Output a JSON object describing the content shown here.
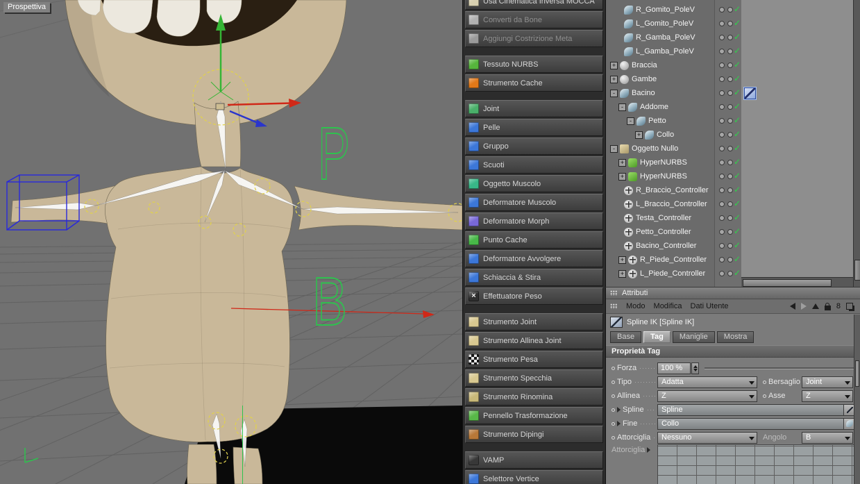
{
  "colors": {
    "viewport_bg": "#717171",
    "model_skin": "#c9b899",
    "gizmo_green": "#35b535",
    "gizmo_red": "#d02818",
    "gizmo_blue": "#2a35cc",
    "joint_circle_yellow": "#e0d14e",
    "overlay_letter_green": "#2ec24e",
    "wire_cube_blue": "#2828dc",
    "check_green": "#2fd14a",
    "selected_tag_blue": "#8da8dc"
  },
  "viewport": {
    "label": "Prospettiva",
    "overlay_letters": [
      "P",
      "B"
    ]
  },
  "palette": {
    "groups": [
      {
        "items": [
          {
            "label": "Usa Cinematica Inversa MOCCA",
            "icon": "ik-mocca-icon",
            "color": "#d8d0b0",
            "disabled": false
          },
          {
            "label": "Converti da Bone",
            "icon": "convert-bone-icon",
            "color": "#b0b0b0",
            "disabled": true
          },
          {
            "label": "Aggiungi Costrizione Meta",
            "icon": "meta-constraint-icon",
            "color": "#9a9a9a",
            "disabled": true
          }
        ]
      },
      {
        "items": [
          {
            "label": "Tessuto NURBS",
            "icon": "cloth-nurbs-icon",
            "color": "#56b53c"
          },
          {
            "label": "Strumento Cache",
            "icon": "cache-tool-icon",
            "color": "#e07818"
          }
        ]
      },
      {
        "items": [
          {
            "label": "Joint",
            "icon": "joint-icon",
            "color": "#4ab06a"
          },
          {
            "label": "Pelle",
            "icon": "skin-icon",
            "color": "#3c77d8"
          },
          {
            "label": "Gruppo",
            "icon": "cluster-icon",
            "color": "#3c77d8"
          },
          {
            "label": "Scuoti",
            "icon": "jiggle-icon",
            "color": "#3c77d8"
          },
          {
            "label": "Oggetto Muscolo",
            "icon": "muscle-object-icon",
            "color": "#38b888"
          },
          {
            "label": "Deformatore Muscolo",
            "icon": "muscle-deformer-icon",
            "color": "#3c77d8"
          },
          {
            "label": "Deformatore Morph",
            "icon": "morph-deformer-icon",
            "color": "#7868d8"
          },
          {
            "label": "Punto Cache",
            "icon": "point-cache-icon",
            "color": "#48b848"
          },
          {
            "label": "Deformatore Avvolgere",
            "icon": "wrap-deformer-icon",
            "color": "#3c77d8"
          },
          {
            "label": "Schiaccia & Stira",
            "icon": "squash-stretch-icon",
            "color": "#3c77d8"
          },
          {
            "label": "Effettuatore Peso",
            "icon": "weight-effector-icon",
            "color": "#2e2e2e",
            "glyph": "×"
          }
        ]
      },
      {
        "items": [
          {
            "label": "Strumento Joint",
            "icon": "joint-tool-icon",
            "color": "#d8c890"
          },
          {
            "label": "Strumento Allinea Joint",
            "icon": "align-joint-tool-icon",
            "color": "#d8c890"
          },
          {
            "label": "Strumento Pesa",
            "icon": "weight-tool-icon",
            "color": "#202020",
            "checker": true
          },
          {
            "label": "Strumento Specchia",
            "icon": "mirror-tool-icon",
            "color": "#d8c890"
          },
          {
            "label": "Strumento Rinomina",
            "icon": "rename-tool-icon",
            "color": "#c8b878"
          },
          {
            "label": "Pennello Trasformazione",
            "icon": "transform-brush-icon",
            "color": "#58b848"
          },
          {
            "label": "Strumento Dipingi",
            "icon": "paint-tool-icon",
            "color": "#b87838"
          }
        ]
      },
      {
        "items": [
          {
            "label": "VAMP",
            "icon": "vamp-icon",
            "color": "#383838"
          },
          {
            "label": "Selettore Vertice",
            "icon": "vertex-selector-icon",
            "color": "#3c77d8"
          }
        ]
      }
    ]
  },
  "object_manager": {
    "items": [
      {
        "name": "R_Gomito_PoleV",
        "level": 1,
        "expander": null,
        "icon": "joint"
      },
      {
        "name": "L_Gomito_PoleV",
        "level": 1,
        "expander": null,
        "icon": "joint"
      },
      {
        "name": "R_Gamba_PoleV",
        "level": 1,
        "expander": null,
        "icon": "joint"
      },
      {
        "name": "L_Gamba_PoleV",
        "level": 1,
        "expander": null,
        "icon": "joint"
      },
      {
        "name": "Braccia",
        "level": 0,
        "expander": "plus",
        "icon": "group"
      },
      {
        "name": "Gambe",
        "level": 0,
        "expander": "plus",
        "icon": "group"
      },
      {
        "name": "Bacino",
        "level": 0,
        "expander": "minus",
        "icon": "joint",
        "tag": "spline-ik"
      },
      {
        "name": "Addome",
        "level": 1,
        "expander": "minus",
        "icon": "joint"
      },
      {
        "name": "Petto",
        "level": 2,
        "expander": "minus",
        "icon": "joint"
      },
      {
        "name": "Collo",
        "level": 3,
        "expander": "plus",
        "icon": "joint"
      },
      {
        "name": "Oggetto Nullo",
        "level": 0,
        "expander": "minus",
        "icon": "null"
      },
      {
        "name": "HyperNURBS",
        "level": 1,
        "expander": "plus",
        "icon": "hypernurbs"
      },
      {
        "name": "HyperNURBS",
        "level": 1,
        "expander": "plus",
        "icon": "hypernurbs"
      },
      {
        "name": "R_Braccio_Controller",
        "level": 1,
        "expander": null,
        "icon": "controller"
      },
      {
        "name": "L_Braccio_Controller",
        "level": 1,
        "expander": null,
        "icon": "controller"
      },
      {
        "name": "Testa_Controller",
        "level": 1,
        "expander": null,
        "icon": "controller"
      },
      {
        "name": "Petto_Controller",
        "level": 1,
        "expander": null,
        "icon": "controller"
      },
      {
        "name": "Bacino_Controller",
        "level": 1,
        "expander": null,
        "icon": "controller"
      },
      {
        "name": "R_Piede_Controller",
        "level": 1,
        "expander": "plus",
        "icon": "controller"
      },
      {
        "name": "L_Piede_Controller",
        "level": 1,
        "expander": "plus",
        "icon": "controller"
      }
    ]
  },
  "attributes": {
    "panel_title": "Attributi",
    "menu_items": [
      "Modo",
      "Modifica",
      "Dati Utente"
    ],
    "link_count": "8",
    "object_title": "Spline IK [Spline IK]",
    "tabs": [
      {
        "label": "Base",
        "active": false
      },
      {
        "label": "Tag",
        "active": true
      },
      {
        "label": "Maniglie",
        "active": false
      },
      {
        "label": "Mostra",
        "active": false
      }
    ],
    "section_title": "Proprietà Tag",
    "forza": {
      "label": "Forza",
      "value": "100 %"
    },
    "tipo": {
      "label": "Tipo",
      "value": "Adatta"
    },
    "bersaglio": {
      "label": "Bersaglio",
      "value": "Joint"
    },
    "allinea": {
      "label": "Allinea",
      "value": "Z"
    },
    "asse": {
      "label": "Asse",
      "value": "Z"
    },
    "spline": {
      "label": "Spline",
      "value": "Spline"
    },
    "fine": {
      "label": "Fine",
      "value": "Collo"
    },
    "attorciglia": {
      "label": "Attorciglia",
      "value": "Nessuno"
    },
    "angolo": {
      "label": "Angolo",
      "value": "B"
    },
    "attorciglia_ramp": {
      "label": "Attorciglia"
    }
  }
}
